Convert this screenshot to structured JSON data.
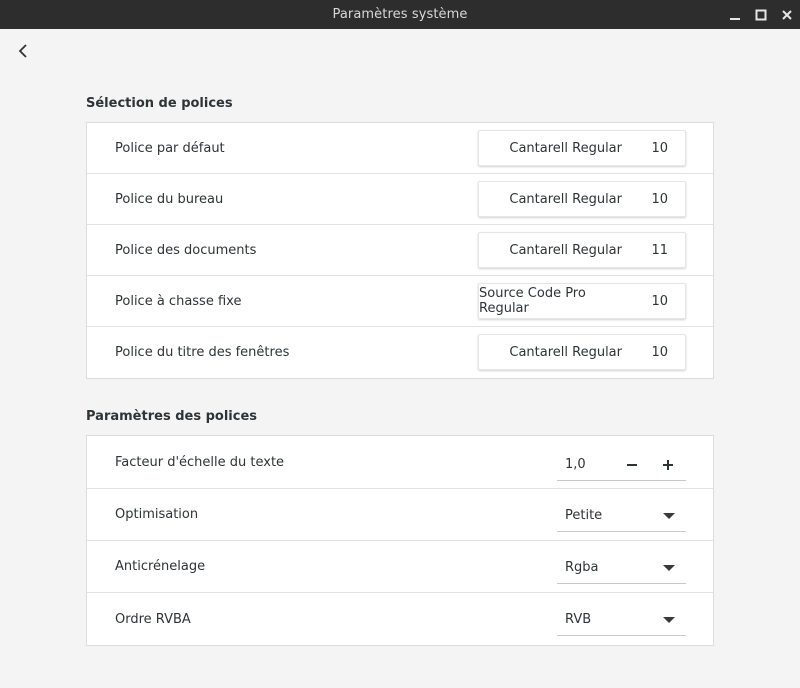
{
  "window": {
    "title": "Paramètres système"
  },
  "font_selection": {
    "heading": "Sélection de polices",
    "rows": [
      {
        "label": "Police par défaut",
        "font": "Cantarell Regular",
        "size": "10"
      },
      {
        "label": "Police du bureau",
        "font": "Cantarell Regular",
        "size": "10"
      },
      {
        "label": "Police des documents",
        "font": "Cantarell Regular",
        "size": "11"
      },
      {
        "label": "Police à chasse fixe",
        "font": "Source Code Pro Regular",
        "size": "10"
      },
      {
        "label": "Police du titre des fenêtres",
        "font": "Cantarell Regular",
        "size": "10"
      }
    ]
  },
  "font_settings": {
    "heading": "Paramètres des polices",
    "scale": {
      "label": "Facteur d'échelle du texte",
      "value": "1,0",
      "minus": "−",
      "plus": "+"
    },
    "hinting": {
      "label": "Optimisation",
      "value": "Petite"
    },
    "antialiasing": {
      "label": "Anticrénelage",
      "value": "Rgba"
    },
    "rgba_order": {
      "label": "Ordre RVBA",
      "value": "RVB"
    }
  }
}
